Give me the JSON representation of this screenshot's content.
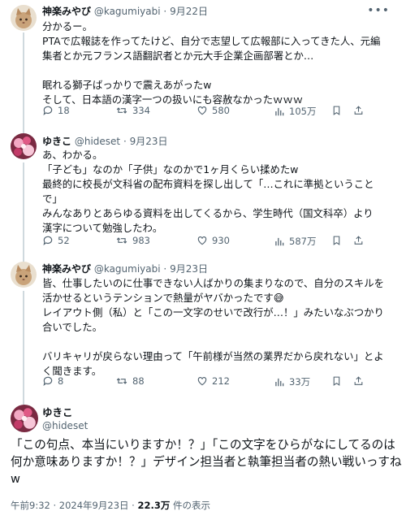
{
  "tweets": [
    {
      "name": "神楽みやび",
      "handle": "@kagumiyabi",
      "date": "9月22日",
      "lines": [
        "分かるー。",
        "PTAで広報誌を作ってたけど、自分で志望して広報部に入ってきた人、元編",
        "集者とか元フランス語翻訳者とか元大手企業企画部署とか…",
        "",
        "眠れる獅子ばっかりで震えあがったw",
        "そして、日本語の漢字一つの扱いにも容赦なかったｗｗｗ"
      ],
      "replies": "18",
      "retweets": "334",
      "likes": "580",
      "views": "105万"
    },
    {
      "name": "ゆきこ",
      "handle": "@hideset",
      "date": "9月23日",
      "lines": [
        "あ、わかる。",
        "「子ども」なのか「子供」なのかで1ヶ月くらい揉めたw",
        "最終的に校長が文科省の配布資料を探し出して「…これに準拠ということ",
        "で」",
        "みんなありとあらゆる資料を出してくるから、学生時代（国文科卒）より",
        "漢字について勉強したわ。"
      ],
      "replies": "52",
      "retweets": "983",
      "likes": "930",
      "views": "587万"
    },
    {
      "name": "神楽みやび",
      "handle": "@kagumiyabi",
      "date": "9月23日",
      "lines": [
        "皆、仕事したいのに仕事できない人ばかりの集まりなので、自分のスキルを",
        "活かせるというテンションで熱量がヤバかったです😅",
        "レイアウト側（私）と「この一文字のせいで改行が…！」みたいなぶつかり",
        "合いでした。",
        "",
        "バリキャリが戻らない理由って「午前様が当然の業界だから戻れない」とよ",
        "く聞きます。"
      ],
      "replies": "8",
      "retweets": "88",
      "likes": "212",
      "views": "33万"
    }
  ],
  "main": {
    "name": "ゆきこ",
    "handle": "@hideset",
    "lines": [
      "「この句点、本当にいりますか！？」「この文字をひらがなにしてるのは",
      "何か意味ありますか！？」デザイン担当者と執筆担当者の熱い戦いっすね",
      "w"
    ],
    "time": "午前9:32 · 2024年9月23日 ·",
    "views": "22.3万",
    "views_label": "件の表示"
  },
  "colors": {
    "text": "#0f1419",
    "secondary": "#536471",
    "thread": "#cfd9de"
  }
}
